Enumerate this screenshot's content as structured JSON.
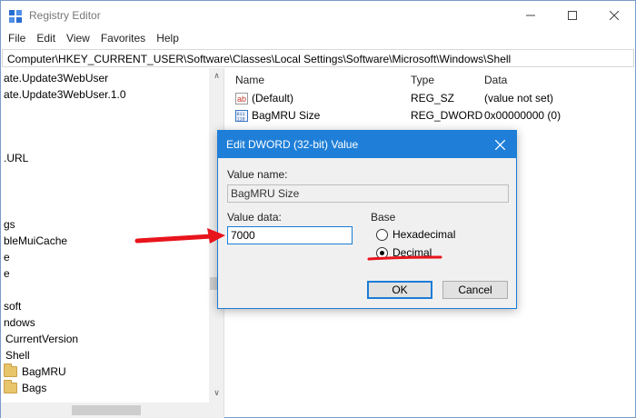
{
  "window": {
    "title": "Registry Editor",
    "minimize_glyph": "—",
    "maximize_glyph": "☐",
    "close_glyph": "✕"
  },
  "menu": [
    "File",
    "Edit",
    "View",
    "Favorites",
    "Help"
  ],
  "address": "Computer\\HKEY_CURRENT_USER\\Software\\Classes\\Local Settings\\Software\\Microsoft\\Windows\\Shell",
  "tree": {
    "items": [
      "ate.Update3WebUser",
      "ate.Update3WebUser.1.0",
      ".URL",
      "gs",
      "bleMuiCache",
      "e",
      "e",
      "soft",
      "ndows",
      "CurrentVersion",
      "Shell",
      "BagMRU",
      "Bags"
    ],
    "scroll_up": "∧",
    "scroll_down": "∨"
  },
  "list": {
    "columns": [
      "Name",
      "Type",
      "Data"
    ],
    "rows": [
      {
        "name": "(Default)",
        "type": "REG_SZ",
        "data": "(value not set)",
        "icon": "string-value-icon"
      },
      {
        "name": "BagMRU Size",
        "type": "REG_DWORD",
        "data": "0x00000000 (0)",
        "icon": "binary-value-icon"
      }
    ]
  },
  "dialog": {
    "title": "Edit DWORD (32-bit) Value",
    "close_glyph": "✕",
    "value_name_label": "Value name:",
    "value_name": "BagMRU Size",
    "value_data_label": "Value data:",
    "value_data": "7000",
    "base_label": "Base",
    "base_options": [
      {
        "label": "Hexadecimal",
        "checked": false
      },
      {
        "label": "Decimal",
        "checked": true
      }
    ],
    "ok_label": "OK",
    "cancel_label": "Cancel"
  },
  "colors": {
    "accent": "#1f7fd8",
    "annotation": "#e8141c",
    "folder": "#e8c46a"
  }
}
